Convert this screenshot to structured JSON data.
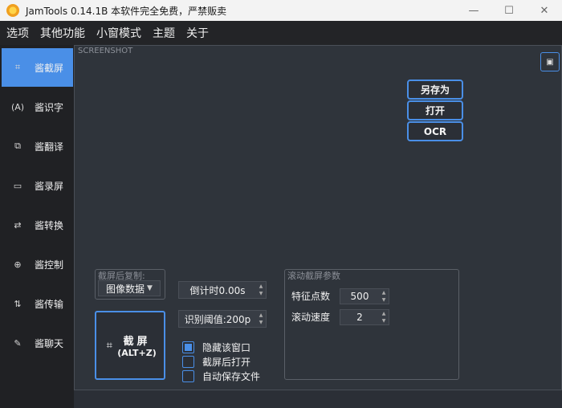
{
  "window": {
    "title": "JamTools 0.14.1B 本软件完全免费，严禁贩卖",
    "minimize": "—",
    "maximize": "☐",
    "close": "✕"
  },
  "menu": [
    "选项",
    "其他功能",
    "小窗模式",
    "主题",
    "关于"
  ],
  "sidebar": {
    "items": [
      {
        "label": "酱截屏",
        "icon": "crop-icon",
        "glyph": "⌗"
      },
      {
        "label": "酱识字",
        "icon": "text-scan-icon",
        "glyph": "(A)"
      },
      {
        "label": "酱翻译",
        "icon": "translate-icon",
        "glyph": "⧉"
      },
      {
        "label": "酱录屏",
        "icon": "video-icon",
        "glyph": "▭"
      },
      {
        "label": "酱转换",
        "icon": "convert-icon",
        "glyph": "⇄"
      },
      {
        "label": "酱控制",
        "icon": "control-icon",
        "glyph": "⊕"
      },
      {
        "label": "酱传输",
        "icon": "transfer-icon",
        "glyph": "⇅"
      },
      {
        "label": "酱聊天",
        "icon": "chat-icon",
        "glyph": "✎"
      }
    ]
  },
  "main": {
    "section_label": "SCREENSHOT",
    "corner_glyph": "▣",
    "actions": {
      "save_as": "另存为",
      "open": "打开",
      "ocr": "OCR"
    },
    "copy_after": {
      "title": "截屏后复制:",
      "value": "图像数据",
      "arrow": "▼"
    },
    "countdown": "倒计时0.00s",
    "threshold": "识别阈值:200p",
    "screenshot_button": {
      "line1": "截屏",
      "line2": "(ALT+Z)",
      "glyph": "⌗"
    },
    "checks": [
      {
        "label": "隐藏该窗口",
        "checked": true
      },
      {
        "label": "截屏后打开",
        "checked": false
      },
      {
        "label": "自动保存文件",
        "checked": false
      }
    ],
    "scroll_params": {
      "title": "滚动截屏参数",
      "feature_label": "特征点数",
      "feature_value": "500",
      "speed_label": "滚动速度",
      "speed_value": "2"
    },
    "spin_up": "▲",
    "spin_down": "▼"
  }
}
